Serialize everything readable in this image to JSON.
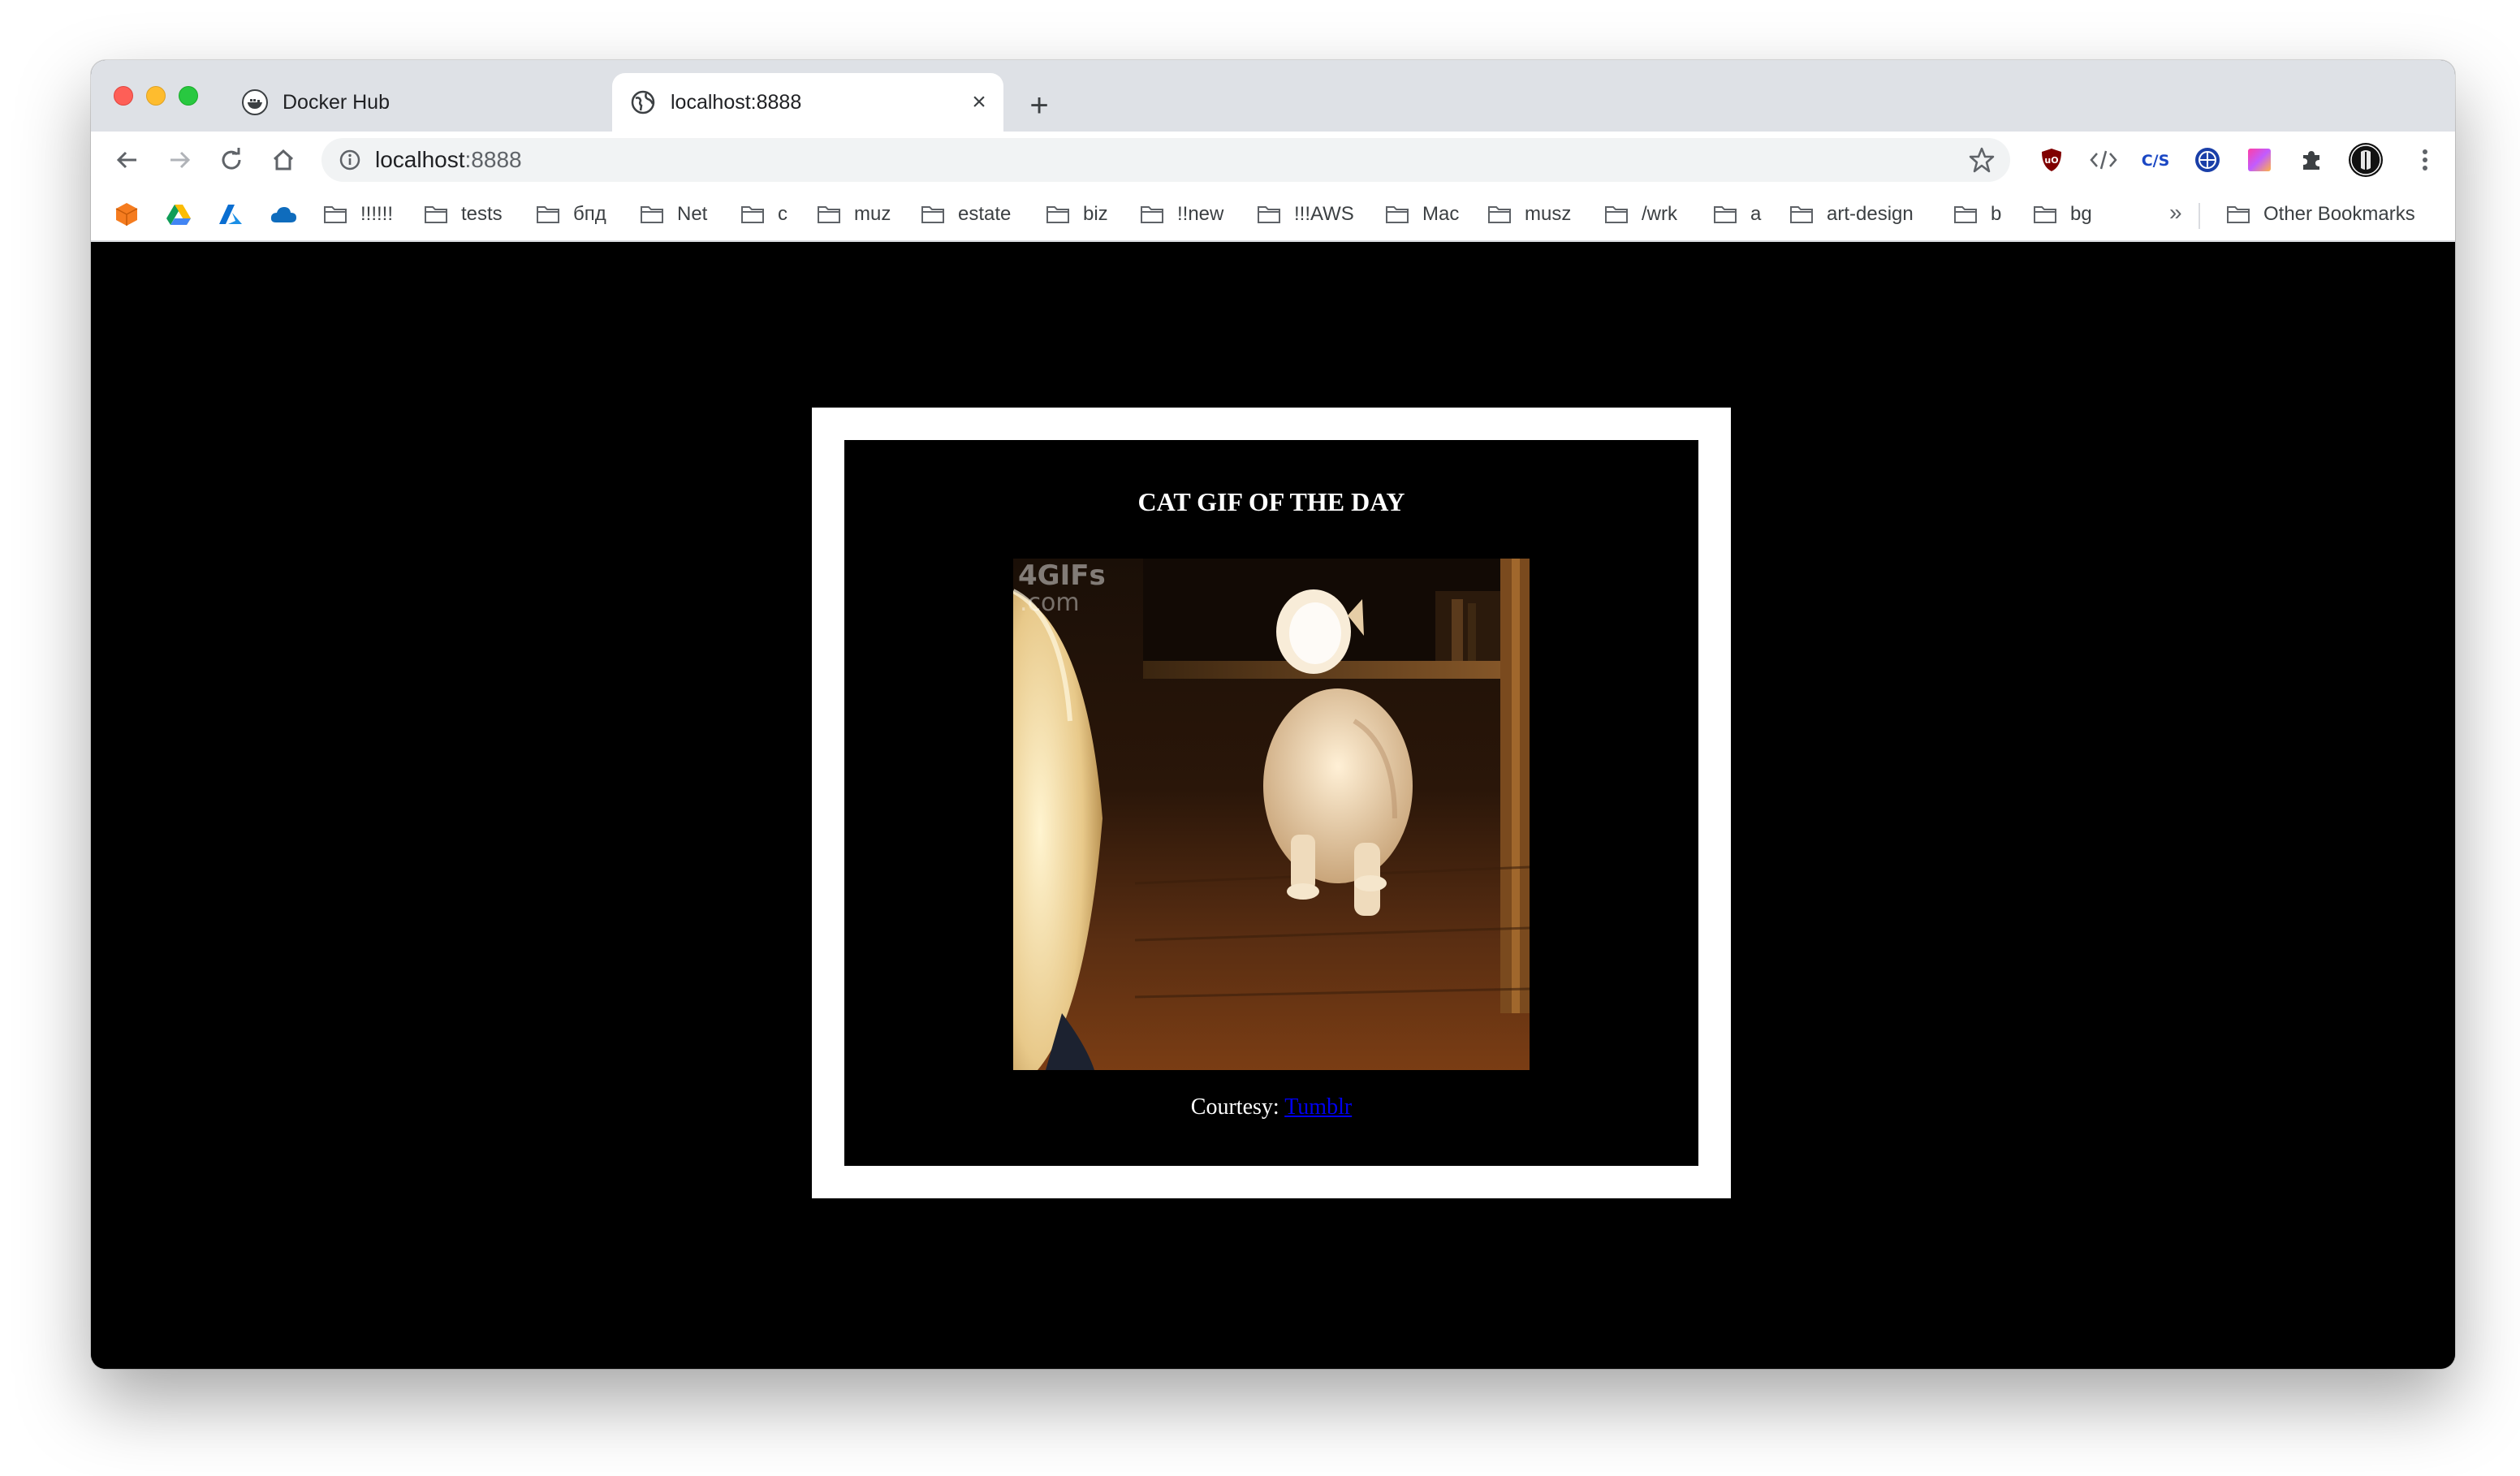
{
  "browser": {
    "tabs": [
      {
        "title": "Docker Hub",
        "favicon": "docker-icon",
        "active": false
      },
      {
        "title": "localhost:8888",
        "favicon": "globe-icon",
        "active": true
      }
    ],
    "new_tab_label": "+",
    "close_label": "×",
    "address": {
      "host": "localhost",
      "port": ":8888"
    },
    "extensions": [
      "ublock-icon",
      "code-icon",
      "css-icon",
      "vpn-globe-icon",
      "gradient-icon",
      "puzzle-icon",
      "profile-avatar",
      "menu-kebab-icon"
    ]
  },
  "bookmarks": {
    "items": [
      "!!!!!!",
      "tests",
      "бпд",
      "Net",
      "c",
      "muz",
      "estate",
      "biz",
      "!!new",
      "!!!AWS",
      "Mac",
      "musz",
      "/wrk",
      "a",
      "art-design",
      "b",
      "bg"
    ],
    "overflow": "»",
    "other": "Other Bookmarks"
  },
  "page": {
    "headline": "CAT GIF OF THE DAY",
    "gif_watermark": "4GIFs.com",
    "courtesy_prefix": "Courtesy: ",
    "courtesy_link": "Tumblr"
  },
  "colors": {
    "tabstrip": "#dee1e6",
    "page_background": "#000000",
    "frame": "#ffffff",
    "link": "#0000ee"
  }
}
